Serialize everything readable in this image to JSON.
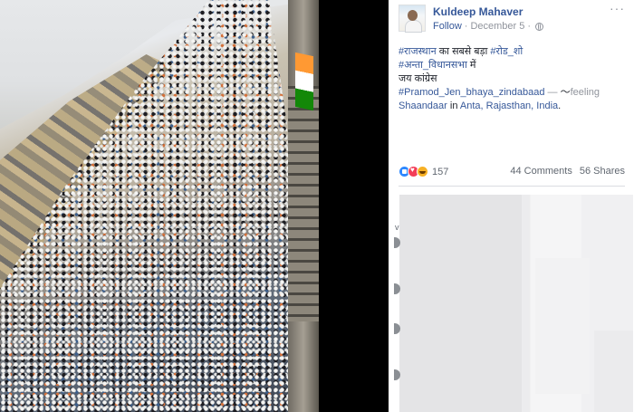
{
  "post": {
    "author": "Kuldeep Mahaver",
    "follow": "Follow",
    "separator": "·",
    "date": "December 5",
    "separator2": "·",
    "more": "···",
    "line1_tag1": "#राजस्थान",
    "line1_text": " का सबसे बड़ा ",
    "line1_tag2": "#रोड_शो",
    "line2_tag": "#अन्ता_विधानसभा",
    "line2_text": " में",
    "line3_text": "जय कांग्रेस",
    "line4_tag": "#Pramod_Jen_bhaya_zindabaad",
    "line4_dash": " — ",
    "feeling_glyph": "〜",
    "feeling_text": "feeling",
    "feeling_value": "Shaandaar",
    "in_text": " in ",
    "location": "Anta, Rajasthan, India",
    "location_end": "."
  },
  "engagement": {
    "reactions_count": "157",
    "comments": "44 Comments",
    "shares": "56 Shares"
  },
  "side_mark": "v",
  "colors": {
    "link": "#365899",
    "muted": "#90949c",
    "text": "#1d2129"
  },
  "icons": [
    "more-icon",
    "globe-icon",
    "like-icon",
    "love-icon",
    "haha-icon",
    "avatar"
  ]
}
